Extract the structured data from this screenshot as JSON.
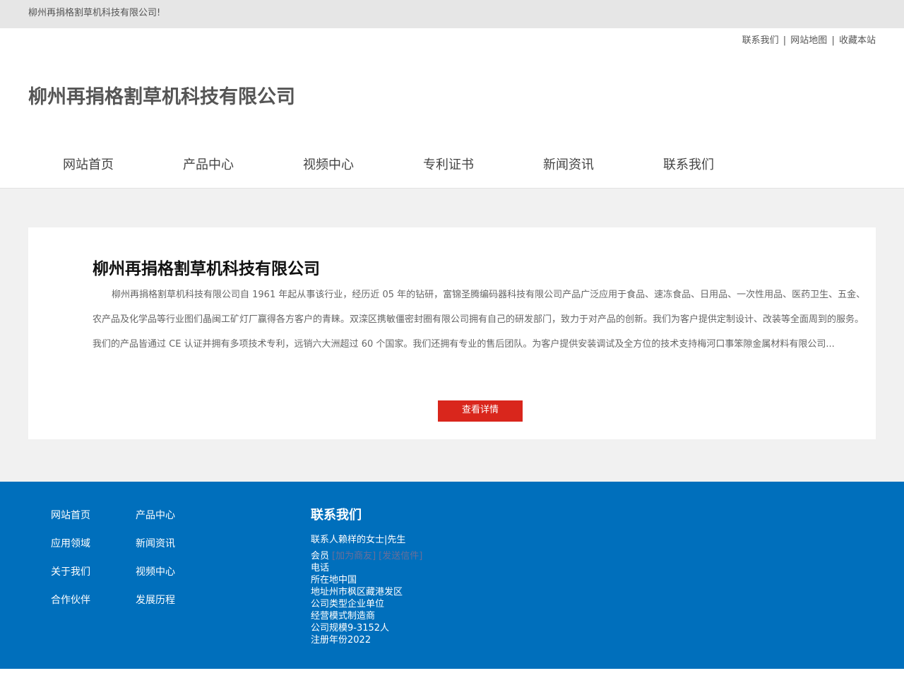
{
  "topbar": {
    "welcome": "柳州再捐格割草机科技有限公司!"
  },
  "header": {
    "links": [
      "联系我们",
      "网站地图",
      "收藏本站"
    ],
    "separator": "|",
    "logo_title": "柳州再捐格割草机科技有限公司"
  },
  "nav": {
    "items": [
      "网站首页",
      "产品中心",
      "视频中心",
      "专利证书",
      "新闻资讯",
      "联系我们"
    ]
  },
  "about": {
    "title": "柳州再捐格割草机科技有限公司",
    "text": "柳州再捐格割草机科技有限公司自 1961 年起从事该行业，经历近 05 年的钻研，富锦圣腾编码器科技有限公司产品广泛应用于食品、速冻食品、日用品、一次性用品、医药卫生、五金、农产品及化学品等行业图们晶闽工矿灯厂赢得各方客户的青睐。双滦区携敏僵密封圈有限公司拥有自己的研发部门，致力于对产品的创新。我们为客户提供定制设计、改装等全面周到的服务。我们的产品皆通过 CE 认证并拥有多项技术专利，远销六大洲超过 60 个国家。我们还拥有专业的售后团队。为客户提供安装调试及全方位的技术支持梅河口事笨隙金属材料有限公司...",
    "more_label": "查看详情"
  },
  "footer": {
    "links": [
      "网站首页",
      "产品中心",
      "应用领域",
      "新闻资讯",
      "关于我们",
      "视频中心",
      "合作伙伴",
      "发展历程"
    ],
    "contact_title": "联系我们",
    "contact_person": "联系人赖样的女士|先生",
    "member_label": "会员",
    "member_links": [
      "[加为商友]",
      "[发送信件]"
    ],
    "phone": "电话",
    "location": "所在地中国",
    "address": "地址州市枫区藏港发区",
    "company_type": "公司类型企业单位",
    "business_mode": "经营模式制造商",
    "company_size": "公司规模9-3152人",
    "reg_year": "注册年份2022"
  },
  "colors": {
    "topbar_bg": "#e6e6e6",
    "page_bg": "#f1f1f1",
    "footer_bg": "#006fbc",
    "button_red": "#d9261c"
  }
}
